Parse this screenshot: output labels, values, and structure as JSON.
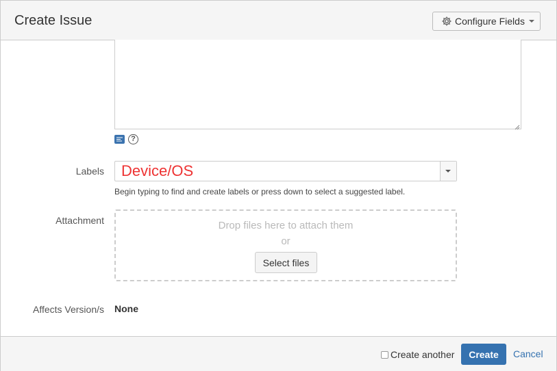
{
  "dialog": {
    "title": "Create Issue",
    "configure_fields_label": "Configure Fields"
  },
  "form": {
    "description_value": "",
    "labels": {
      "label": "Labels",
      "value": "Device/OS",
      "hint": "Begin typing to find and create labels or press down to select a suggested label."
    },
    "attachment": {
      "label": "Attachment",
      "drop_text": "Drop files here to attach them",
      "or_text": "or",
      "select_files_label": "Select files"
    },
    "affects_versions": {
      "label": "Affects Version/s",
      "value": "None"
    }
  },
  "footer": {
    "create_another_label": "Create another",
    "create_another_checked": false,
    "create_label": "Create",
    "cancel_label": "Cancel"
  },
  "colors": {
    "accent": "#3572b0",
    "label_value": "#ee3333",
    "header_bg": "#f5f5f5"
  },
  "icons": [
    "gear-icon",
    "chevron-down-icon",
    "wiki-style-icon",
    "help-icon",
    "resize-grip-icon"
  ]
}
